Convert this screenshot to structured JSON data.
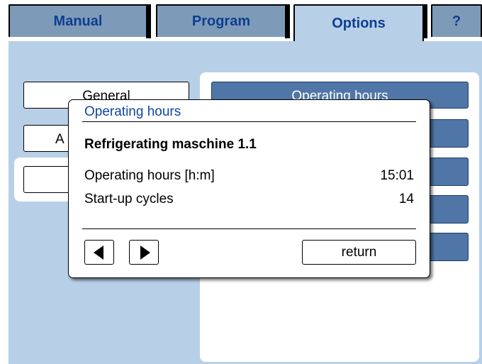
{
  "tabs": [
    {
      "label": "Manual",
      "active": false
    },
    {
      "label": "Program",
      "active": false
    },
    {
      "label": "Options",
      "active": true
    },
    {
      "label": "?",
      "active": false
    }
  ],
  "left_buttons": [
    "General",
    "A",
    ""
  ],
  "right_buttons": [
    "Operating hours",
    "",
    "",
    "",
    ""
  ],
  "dialog": {
    "title": "Operating hours",
    "device": "Refrigerating maschine 1.1",
    "rows": [
      {
        "label": "Operating hours [h:m]",
        "value": "15:01"
      },
      {
        "label": "Start-up cycles",
        "value": "14"
      }
    ],
    "return_label": "return"
  },
  "colors": {
    "background": "#b8cfe8",
    "tab_inactive": "#7d9bb8",
    "tab_text": "#0f3d8f",
    "button_blue": "#4f76a6",
    "dialog_title": "#0d47a1"
  }
}
